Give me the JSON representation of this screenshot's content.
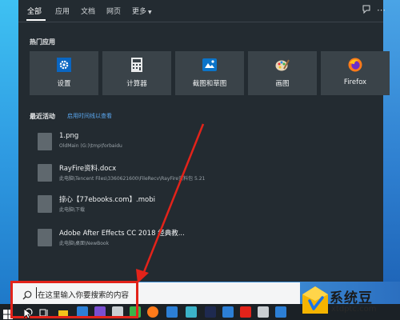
{
  "scope_tabs": {
    "all": "全部",
    "apps": "应用",
    "documents": "文档",
    "web": "网页",
    "more": "更多"
  },
  "header_icons": {
    "feedback": "feedback-icon",
    "options": "ellipsis-icon"
  },
  "top_apps": {
    "title": "热门应用",
    "items": [
      {
        "label": "设置",
        "icon": "gear-icon"
      },
      {
        "label": "计算器",
        "icon": "calculator-icon"
      },
      {
        "label": "截图和草图",
        "icon": "snip-sketch-icon"
      },
      {
        "label": "画图",
        "icon": "paint-icon"
      },
      {
        "label": "Firefox",
        "icon": "firefox-icon"
      }
    ]
  },
  "recent": {
    "title": "最近活动",
    "link": "启用时间线以查看",
    "items": [
      {
        "name": "1.png",
        "path": "OldMain (G:)\\tmp\\forbaidu"
      },
      {
        "name": "RayFire资料.docx",
        "path": "此电脑\\Tencent Files\\3360621600\\FileRecv\\RayFire资料包 5.21"
      },
      {
        "name": "掠心【77ebooks.com】.mobi",
        "path": "此电脑\\下载"
      },
      {
        "name": "Adobe After Effects CC 2018 经典教...",
        "path": "此电脑\\桌面\\NewBook"
      }
    ]
  },
  "search": {
    "placeholder": "在这里输入你要搜索的内容"
  },
  "watermark": {
    "text": "系统豆",
    "url": "xtdptc.com"
  },
  "colors": {
    "panel": "#232b31",
    "tile": "#3a4349",
    "accent_link": "#5aa7ef",
    "highlight": "#e2231a"
  }
}
